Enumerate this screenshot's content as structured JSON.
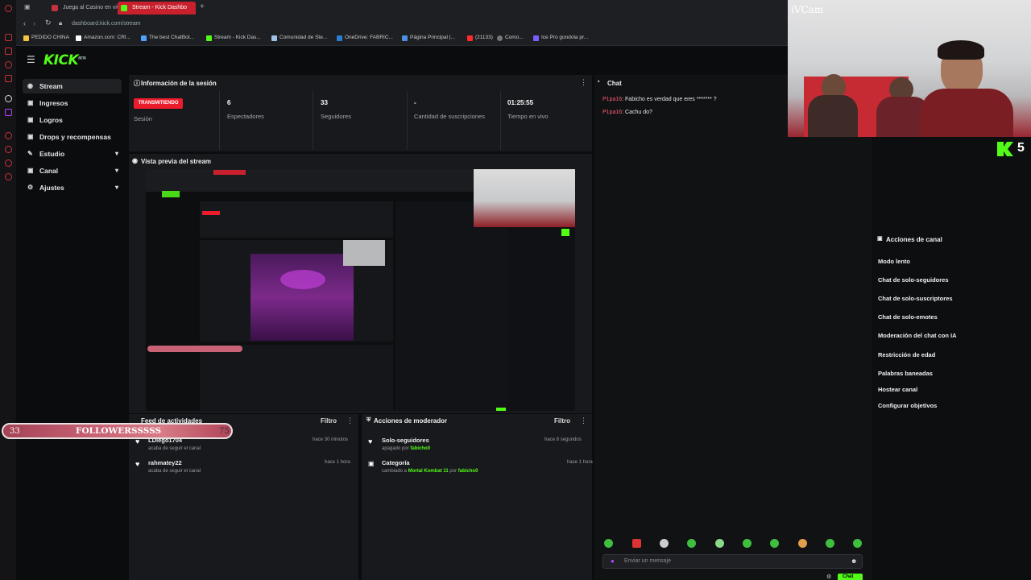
{
  "browser": {
    "tabs": [
      {
        "label": "Juega al Casino en vivo (",
        "active": false
      },
      {
        "label": "Stream - Kick Dashbo",
        "active": true
      }
    ],
    "new_tab_label": "+",
    "url": "dashboard.kick.com/stream",
    "bookmarks": [
      {
        "label": "PEDIDO CHINA",
        "icon": "folder-icon",
        "color": "#f5c542"
      },
      {
        "label": "Amazon.com: CRI...",
        "icon": "amazon-icon",
        "color": "#ffffff"
      },
      {
        "label": "The best ChatBot...",
        "icon": "chatbot-icon",
        "color": "#4da3ff"
      },
      {
        "label": "Stream - Kick Das...",
        "icon": "kick-icon",
        "color": "#53fc18"
      },
      {
        "label": "Comunidad de Ste...",
        "icon": "steam-icon",
        "color": "#9ec3e6"
      },
      {
        "label": "OneDrive: FABRIC...",
        "icon": "onedrive-icon",
        "color": "#2b7cd3"
      },
      {
        "label": "Página Principal |...",
        "icon": "page-icon",
        "color": "#4a8fe0"
      },
      {
        "label": "(21133)",
        "icon": "youtube-icon",
        "color": "#ff2a2a"
      },
      {
        "label": "Como...",
        "icon": "link-icon",
        "color": "#aaaaaa"
      },
      {
        "label": "Ice Pro gondola pr...",
        "icon": "shop-icon",
        "color": "#7b5cff"
      }
    ]
  },
  "kick": {
    "logo": "KICK",
    "logo_sup": "BETA",
    "sidebar": [
      {
        "label": "Stream",
        "icon": "broadcast-icon",
        "active": true,
        "expand": false
      },
      {
        "label": "Ingresos",
        "icon": "wallet-icon",
        "active": false,
        "expand": false
      },
      {
        "label": "Logros",
        "icon": "trophy-icon",
        "active": false,
        "expand": false
      },
      {
        "label": "Drops y recompensas",
        "icon": "gift-icon",
        "active": false,
        "expand": false
      },
      {
        "label": "Estudio",
        "icon": "pen-icon",
        "active": false,
        "expand": true
      },
      {
        "label": "Canal",
        "icon": "channel-icon",
        "active": false,
        "expand": true
      },
      {
        "label": "Ajustes",
        "icon": "gear-icon",
        "active": false,
        "expand": true
      }
    ],
    "session": {
      "title": "Información de la sesión",
      "live_badge": "TRANSMITIENDO",
      "session_label": "Sesión",
      "stats": [
        {
          "value": "6",
          "label": "Espectadores"
        },
        {
          "value": "33",
          "label": "Seguidores"
        },
        {
          "value": "-",
          "label": "Cantidad de suscripciones"
        },
        {
          "value": "01:25:55",
          "label": "Tiempo en vivo"
        }
      ]
    },
    "preview": {
      "title": "Vista previa del stream"
    },
    "activity": {
      "title": "Feed de actividades",
      "filter": "Filtro",
      "items": [
        {
          "name": "LDiego1704",
          "sub": "acaba de seguir el canal",
          "time": "hace 30 minutos"
        },
        {
          "name": "rahmatey22",
          "sub": "acaba de seguir el canal",
          "time": "hace 1 hora"
        }
      ]
    },
    "moderator": {
      "title": "Acciones de moderador",
      "filter": "Filtro",
      "items": [
        {
          "name": "Solo-seguidores",
          "sub_prefix": "apagado por",
          "sub_value": "fabicho0",
          "sub_mid": "",
          "sub_by": "",
          "time": "hace 8 segundos"
        },
        {
          "name": "Categoría",
          "sub_prefix": "cambiado a",
          "sub_value": "Mortal Kombat 11",
          "sub_mid": "por",
          "sub_by": "fabicho0",
          "time": "hace 1 hora"
        }
      ]
    },
    "chat": {
      "title": "Chat",
      "messages": [
        {
          "user": "P1pa16",
          "text": ": Fabicho es verdad que eres ******* ?"
        },
        {
          "user": "P1pa16",
          "text": ": Cachu do?"
        }
      ],
      "input_placeholder": "Enviar un mensaje",
      "send_label": "Chat"
    },
    "channel_actions": {
      "title": "Acciones de canal",
      "items": [
        "Modo lento",
        "Chat de solo-seguidores",
        "Chat de solo-suscriptores",
        "Chat de solo-emotes",
        "Moderación del chat con IA",
        "Restricción de edad",
        "Palabras baneadas",
        "Hostear canal",
        "Configurar objetivos"
      ]
    }
  },
  "overlay": {
    "webcam_label": "iVCam",
    "kick_count": "5",
    "followers_left": "33",
    "followers_text": "FOLLOWERSSSSS",
    "followers_right": "75"
  },
  "colors": {
    "kick_green": "#53fc18",
    "live_red": "#eb1c2c",
    "panel": "#18191c",
    "bg": "#0b0c0e"
  }
}
